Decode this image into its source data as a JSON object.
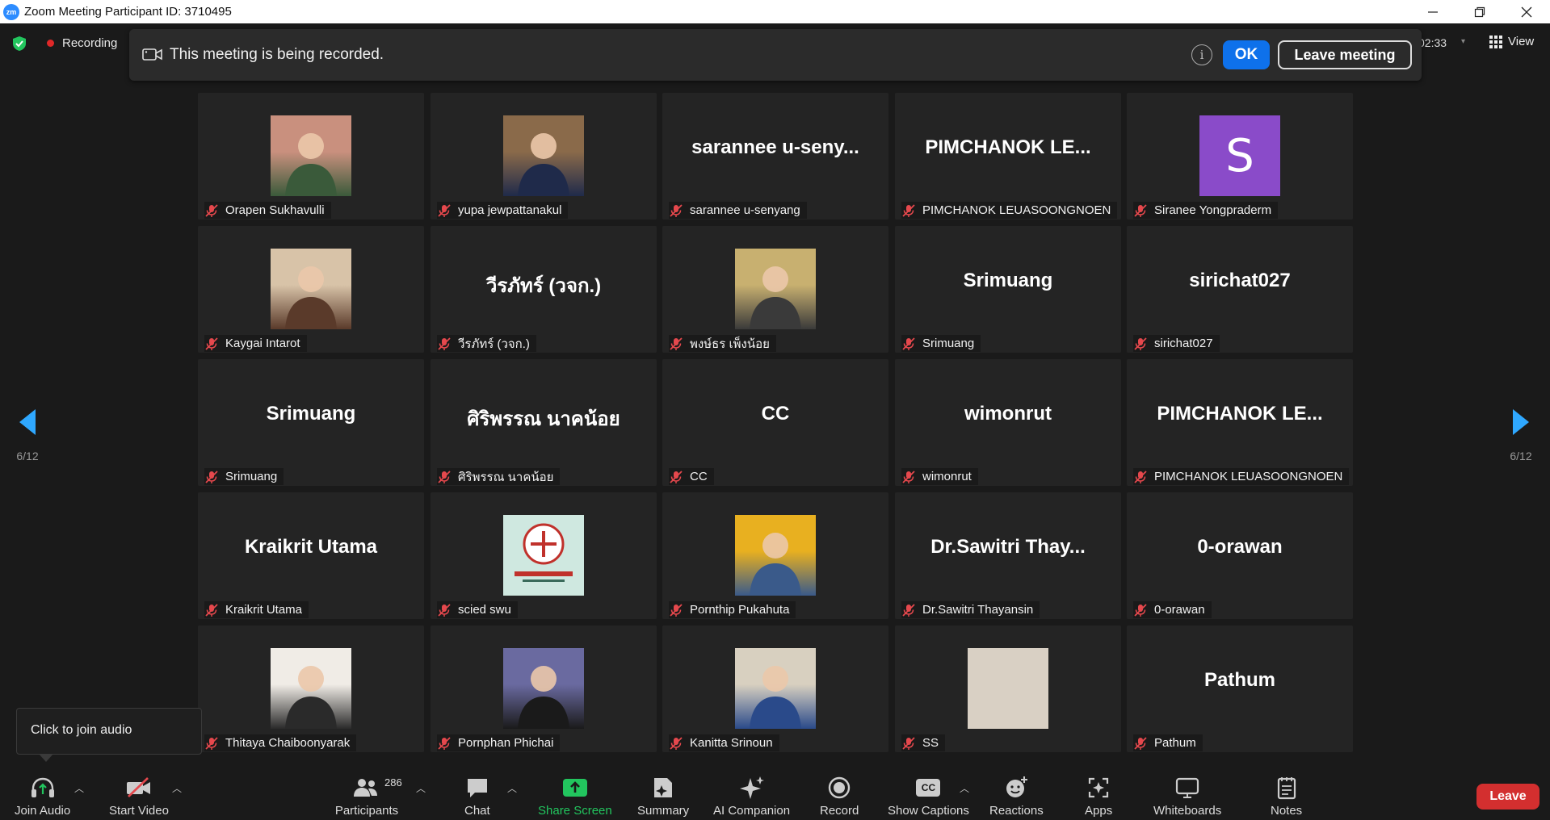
{
  "window": {
    "app_icon": "zm",
    "title": "Zoom Meeting Participant ID: 3710495",
    "controls": [
      "minimize-icon",
      "restore-icon",
      "close-icon"
    ]
  },
  "topbar": {
    "recording_label": "Recording",
    "timer": "02:33",
    "view_label": "View"
  },
  "banner": {
    "message": "This meeting is being recorded.",
    "info": "i",
    "ok_label": "OK",
    "leave_label": "Leave meeting"
  },
  "pager": {
    "left_count": "6/12",
    "right_count": "6/12"
  },
  "participants": [
    {
      "name": "Orapen Sukhavulli",
      "display": "",
      "video": "photo",
      "photo_colors": [
        "#c9907e",
        "#3a5a3a"
      ]
    },
    {
      "name": "yupa jewpattanakul",
      "display": "",
      "video": "photo",
      "photo_colors": [
        "#8a6a4a",
        "#1f2a4a"
      ]
    },
    {
      "name": "sarannee u-senyang",
      "display": "sarannee  u-seny...",
      "video": "name",
      "photo_colors": []
    },
    {
      "name": "PIMCHANOK LEUASOONGNOEN",
      "display": "PIMCHANOK  LE...",
      "video": "name",
      "photo_colors": []
    },
    {
      "name": "Siranee Yongpraderm",
      "display": "S",
      "video": "avatar",
      "photo_colors": [
        "#8a4bc9"
      ]
    },
    {
      "name": "Kaygai Intarot",
      "display": "",
      "video": "photo",
      "photo_colors": [
        "#d8c3a8",
        "#5a3a2a"
      ]
    },
    {
      "name": "วีรภัทร์ (วจก.)",
      "display": "วีรภัทร์ (วจก.)",
      "video": "name",
      "photo_colors": []
    },
    {
      "name": "พงษ์ธร เพ็งน้อย",
      "display": "",
      "video": "photo",
      "photo_colors": [
        "#c8b070",
        "#3a3a3a"
      ]
    },
    {
      "name": "Srimuang",
      "display": "Srimuang",
      "video": "name",
      "photo_colors": []
    },
    {
      "name": "sirichat027",
      "display": "sirichat027",
      "video": "name",
      "photo_colors": []
    },
    {
      "name": "Srimuang",
      "display": "Srimuang",
      "video": "name",
      "photo_colors": []
    },
    {
      "name": "ศิริพรรณ นาคน้อย",
      "display": "ศิริพรรณ  นาคน้อย",
      "video": "name",
      "photo_colors": []
    },
    {
      "name": "CC",
      "display": "CC",
      "video": "name",
      "photo_colors": []
    },
    {
      "name": "wimonrut",
      "display": "wimonrut",
      "video": "name",
      "photo_colors": []
    },
    {
      "name": "PIMCHANOK LEUASOONGNOEN",
      "display": "PIMCHANOK  LE...",
      "video": "name",
      "photo_colors": []
    },
    {
      "name": "Kraikrit Utama",
      "display": "Kraikrit  Utama",
      "video": "name",
      "photo_colors": []
    },
    {
      "name": "scied swu",
      "display": "",
      "video": "logo",
      "photo_colors": [
        "#cfe8e0",
        "#c0312b"
      ]
    },
    {
      "name": "Pornthip Pukahuta",
      "display": "",
      "video": "photo",
      "photo_colors": [
        "#e8b020",
        "#3a5a8a"
      ]
    },
    {
      "name": "Dr.Sawitri Thayansin",
      "display": "Dr.Sawitri  Thay...",
      "video": "name",
      "photo_colors": []
    },
    {
      "name": "0-orawan",
      "display": "0-orawan",
      "video": "name",
      "photo_colors": []
    },
    {
      "name": "Thitaya Chaiboonyarak",
      "display": "",
      "video": "photo",
      "photo_colors": [
        "#f0ece6",
        "#2a2a2a"
      ]
    },
    {
      "name": "Pornphan Phichai",
      "display": "",
      "video": "photo",
      "photo_colors": [
        "#6a6aa0",
        "#1a1a1a"
      ]
    },
    {
      "name": "Kanitta Srinoun",
      "display": "",
      "video": "photo",
      "photo_colors": [
        "#d8d0c0",
        "#2a4a8a"
      ]
    },
    {
      "name": "SS",
      "display": "",
      "video": "blank",
      "photo_colors": [
        "#d9d0c4"
      ]
    },
    {
      "name": "Pathum",
      "display": "Pathum",
      "video": "name",
      "photo_colors": []
    }
  ],
  "tooltip": {
    "text": "Click to join audio"
  },
  "toolbar": {
    "join_audio": "Join Audio",
    "start_video": "Start Video",
    "participants": "Participants",
    "participant_count": "286",
    "chat": "Chat",
    "share_screen": "Share Screen",
    "summary": "Summary",
    "ai_companion": "AI Companion",
    "record": "Record",
    "show_captions": "Show Captions",
    "captions_badge": "CC",
    "reactions": "Reactions",
    "apps": "Apps",
    "whiteboards": "Whiteboards",
    "notes": "Notes",
    "leave": "Leave"
  },
  "colors": {
    "accent_blue": "#0e71eb",
    "pager_blue": "#2fa8ff",
    "leave_red": "#d32f2f",
    "share_green": "#22c55e",
    "muted_red": "#e5484d"
  }
}
